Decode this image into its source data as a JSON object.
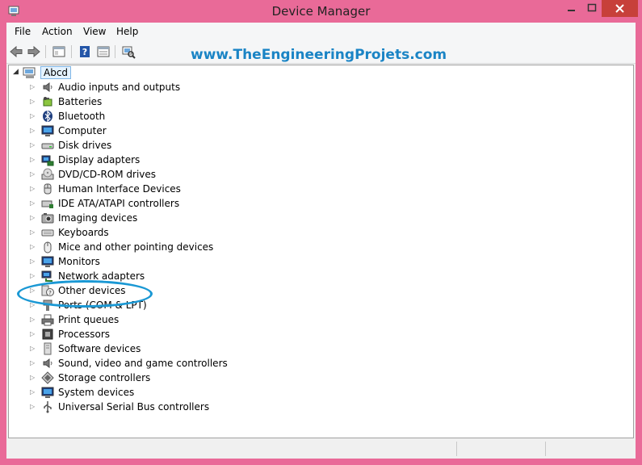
{
  "window": {
    "title": "Device Manager"
  },
  "menu": {
    "items": [
      "File",
      "Action",
      "View",
      "Help"
    ]
  },
  "watermark": "www.TheEngineeringProjets.com",
  "tree": {
    "root": {
      "label": "Abcd",
      "icon": "computer-icon"
    },
    "categories": [
      {
        "label": "Audio inputs and outputs",
        "icon": "speaker-icon"
      },
      {
        "label": "Batteries",
        "icon": "battery-icon"
      },
      {
        "label": "Bluetooth",
        "icon": "bluetooth-icon"
      },
      {
        "label": "Computer",
        "icon": "monitor-icon"
      },
      {
        "label": "Disk drives",
        "icon": "disk-drive-icon"
      },
      {
        "label": "Display adapters",
        "icon": "display-adapter-icon"
      },
      {
        "label": "DVD/CD-ROM drives",
        "icon": "dvd-icon"
      },
      {
        "label": "Human Interface Devices",
        "icon": "hid-icon"
      },
      {
        "label": "IDE ATA/ATAPI controllers",
        "icon": "ide-controller-icon"
      },
      {
        "label": "Imaging devices",
        "icon": "camera-icon"
      },
      {
        "label": "Keyboards",
        "icon": "keyboard-icon"
      },
      {
        "label": "Mice and other pointing devices",
        "icon": "mouse-icon"
      },
      {
        "label": "Monitors",
        "icon": "monitor-icon"
      },
      {
        "label": "Network adapters",
        "icon": "network-icon"
      },
      {
        "label": "Other devices",
        "icon": "unknown-device-icon"
      },
      {
        "label": "Ports (COM & LPT)",
        "icon": "port-icon"
      },
      {
        "label": "Print queues",
        "icon": "printer-icon"
      },
      {
        "label": "Processors",
        "icon": "processor-icon"
      },
      {
        "label": "Software devices",
        "icon": "software-device-icon"
      },
      {
        "label": "Sound, video and game controllers",
        "icon": "speaker-icon"
      },
      {
        "label": "Storage controllers",
        "icon": "storage-controller-icon"
      },
      {
        "label": "System devices",
        "icon": "system-device-icon"
      },
      {
        "label": "Universal Serial Bus controllers",
        "icon": "usb-icon"
      }
    ]
  }
}
